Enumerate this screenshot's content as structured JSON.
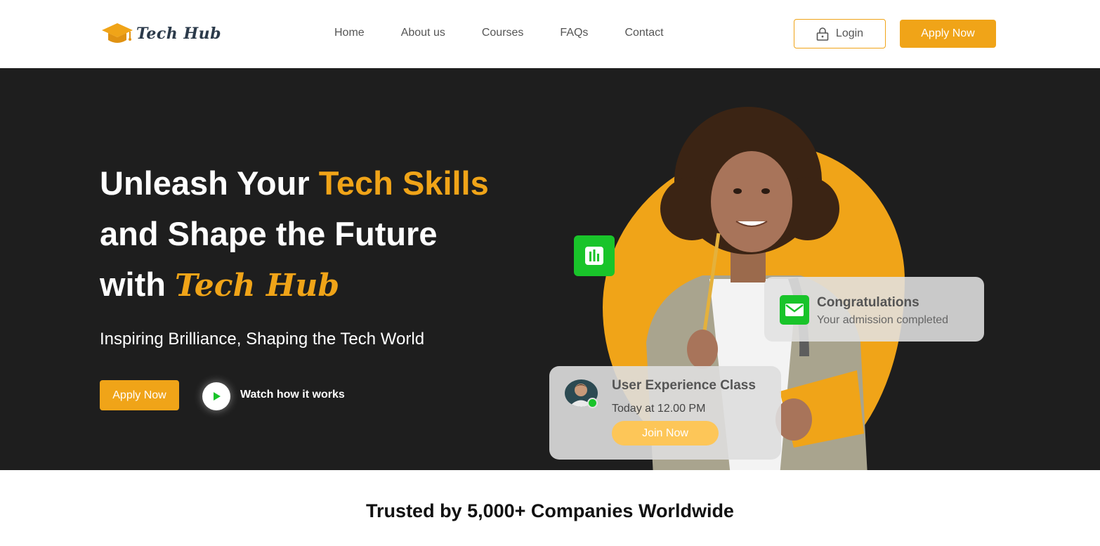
{
  "brand": {
    "name": "Tech Hub",
    "logo_icon": "graduation-cap-icon",
    "accent": "#f0a418"
  },
  "nav": {
    "items": [
      {
        "label": "Home"
      },
      {
        "label": "About us"
      },
      {
        "label": "Courses"
      },
      {
        "label": "FAQs"
      },
      {
        "label": "Contact"
      }
    ]
  },
  "header": {
    "login_label": "Login",
    "login_icon": "lock-icon",
    "apply_label": "Apply Now"
  },
  "hero": {
    "line1_pre": "Unleash Your ",
    "line1_accent": "Tech Skills",
    "line2": "and Shape the Future",
    "line3_pre": "with ",
    "line3_brand": "Tech Hub",
    "subheading": "Inspiring Brilliance, Shaping the Tech World",
    "apply_label": "Apply Now",
    "watch_label": "Watch how it works",
    "play_icon": "play-icon",
    "background": "#1e1e1e"
  },
  "cards": {
    "congrats": {
      "title": "Congratulations",
      "subtitle": "Your admission completed",
      "icon": "mail-icon"
    },
    "class": {
      "title": "User Experience Class",
      "time": "Today at 12.00 PM",
      "join_label": "Join Now"
    },
    "chart_badge_icon": "bar-chart-icon",
    "badge_color": "#19c42a"
  },
  "trusted": {
    "heading": "Trusted by 5,000+ Companies Worldwide"
  }
}
